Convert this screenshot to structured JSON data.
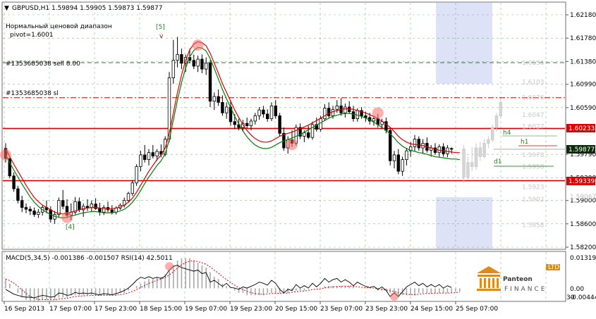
{
  "header": {
    "symbol_line": "GBPUSD,H1  1.59894 1.59905 1.59873 1.59877",
    "indicator_name": "Нормальный ценовой диапазон",
    "pivot_label": "pivot=1.6001"
  },
  "orders": {
    "sell_label": "#1353685038 sell 8.00",
    "sl_label": "#1353685038 sl"
  },
  "annotations": {
    "wave5": "[5]",
    "wave5_marker": "v",
    "wave4": "[4]",
    "h4": "h4",
    "h1": "h1",
    "d1": "d1"
  },
  "levels": {
    "red_upper": "1.60233",
    "red_lower": "1.59339",
    "current": "1.59877"
  },
  "faint_labels": [
    "1.6136",
    "1.6103",
    "1.6076",
    "1.6047",
    "1.6027",
    "1.5978",
    "1.5958",
    "1.5923",
    "1.5902",
    "1.5858"
  ],
  "price_axis": {
    "ticks": [
      "1.62180",
      "1.61780",
      "1.61380",
      "1.60990",
      "1.60590",
      "1.59790",
      "1.59390",
      "1.59000",
      "1.58600",
      "1.58200"
    ],
    "faint_tick": "1.59067"
  },
  "indicator_window": {
    "label": "MACD(5,34,5) -0.001386 -0.001507  RSI(14) 42.5011",
    "axis_ticks": [
      "0.013196",
      "0.00",
      "-0.004443",
      "30"
    ]
  },
  "time_axis": {
    "labels": [
      "16 Sep 2013",
      "17 Sep 07:00",
      "17 Sep 23:00",
      "18 Sep 15:00",
      "19 Sep 07:00",
      "19 Sep 23:00",
      "20 Sep 15:00",
      "23 Sep 07:00",
      "23 Sep 23:00",
      "24 Sep 15:00",
      "25 Sep 07:00"
    ]
  },
  "logo": {
    "name": "Panteon",
    "sub": "FINANCE",
    "badge": "LTD"
  },
  "colors": {
    "bull_candle": "#000000",
    "red_ma": "#dd0000",
    "green_ma": "#008000",
    "level_line": "#dd0000",
    "grid": "#2e7d32",
    "highlight_band": "#dfe3f7",
    "current_price_box": "#0a2a0a",
    "level_box": "#dd0000"
  },
  "candles": [
    [
      1.5989,
      1.5998,
      1.5965,
      1.5972
    ],
    [
      1.5972,
      1.5975,
      1.5938,
      1.5942
    ],
    [
      1.5942,
      1.5948,
      1.5915,
      1.592
    ],
    [
      1.592,
      1.5925,
      1.5895,
      1.59
    ],
    [
      1.59,
      1.5908,
      1.588,
      1.5888
    ],
    [
      1.5888,
      1.5895,
      1.5878,
      1.5885
    ],
    [
      1.5885,
      1.589,
      1.5875,
      1.5882
    ],
    [
      1.5882,
      1.5888,
      1.5872,
      1.5876
    ],
    [
      1.5876,
      1.5885,
      1.587,
      1.588
    ],
    [
      1.588,
      1.5892,
      1.5874,
      1.5888
    ],
    [
      1.5888,
      1.59,
      1.5878,
      1.5884
    ],
    [
      1.5884,
      1.589,
      1.5862,
      1.5868
    ],
    [
      1.5868,
      1.5882,
      1.586,
      1.5876
    ],
    [
      1.5876,
      1.5905,
      1.5872,
      1.59
    ],
    [
      1.59,
      1.5918,
      1.5885,
      1.589
    ],
    [
      1.589,
      1.5902,
      1.587,
      1.5875
    ],
    [
      1.5875,
      1.5895,
      1.5866,
      1.588
    ],
    [
      1.588,
      1.5906,
      1.5876,
      1.5898
    ],
    [
      1.5898,
      1.5905,
      1.588,
      1.5884
    ],
    [
      1.5884,
      1.5895,
      1.5872,
      1.589
    ],
    [
      1.589,
      1.5902,
      1.5882,
      1.5888
    ],
    [
      1.5888,
      1.59,
      1.588,
      1.5894
    ],
    [
      1.5894,
      1.5904,
      1.5884,
      1.5886
    ],
    [
      1.5886,
      1.5896,
      1.5874,
      1.588
    ],
    [
      1.588,
      1.5892,
      1.5875,
      1.5888
    ],
    [
      1.5888,
      1.5898,
      1.588,
      1.5884
    ],
    [
      1.5884,
      1.5892,
      1.5876,
      1.588
    ],
    [
      1.588,
      1.589,
      1.5876,
      1.5887
    ],
    [
      1.5887,
      1.5895,
      1.5884,
      1.5892
    ],
    [
      1.5892,
      1.5905,
      1.5888,
      1.59
    ],
    [
      1.59,
      1.5915,
      1.5896,
      1.5912
    ],
    [
      1.5912,
      1.5935,
      1.5908,
      1.593
    ],
    [
      1.593,
      1.5962,
      1.5925,
      1.5958
    ],
    [
      1.5958,
      1.5985,
      1.595,
      1.5978
    ],
    [
      1.5978,
      1.5995,
      1.5965,
      1.597
    ],
    [
      1.597,
      1.5988,
      1.596,
      1.5982
    ],
    [
      1.5982,
      1.5995,
      1.5972,
      1.5976
    ],
    [
      1.5976,
      1.5988,
      1.5968,
      1.5984
    ],
    [
      1.5984,
      1.5996,
      1.5974,
      1.5979
    ],
    [
      1.5979,
      1.601,
      1.5976,
      1.6005
    ],
    [
      1.6005,
      1.612,
      1.6,
      1.611
    ],
    [
      1.611,
      1.6175,
      1.61,
      1.614
    ],
    [
      1.614,
      1.618,
      1.6128,
      1.615
    ],
    [
      1.615,
      1.616,
      1.6125,
      1.6135
    ],
    [
      1.6135,
      1.615,
      1.612,
      1.6145
    ],
    [
      1.6145,
      1.616,
      1.6135,
      1.614
    ],
    [
      1.614,
      1.615,
      1.6125,
      1.613
    ],
    [
      1.613,
      1.6148,
      1.612,
      1.6142
    ],
    [
      1.6142,
      1.615,
      1.6118,
      1.6125
    ],
    [
      1.6125,
      1.6145,
      1.6115,
      1.6135
    ],
    [
      1.6135,
      1.614,
      1.606,
      1.607
    ],
    [
      1.607,
      1.6085,
      1.6055,
      1.6078
    ],
    [
      1.6078,
      1.609,
      1.6062,
      1.6068
    ],
    [
      1.6068,
      1.608,
      1.6045,
      1.605
    ],
    [
      1.605,
      1.6068,
      1.604,
      1.606
    ],
    [
      1.606,
      1.6072,
      1.6028,
      1.6035
    ],
    [
      1.6035,
      1.6048,
      1.6022,
      1.603
    ],
    [
      1.603,
      1.604,
      1.602,
      1.6025
    ],
    [
      1.6025,
      1.6038,
      1.6018,
      1.6032
    ],
    [
      1.6032,
      1.6042,
      1.6024,
      1.6028
    ],
    [
      1.6028,
      1.604,
      1.602,
      1.6036
    ],
    [
      1.6036,
      1.605,
      1.603,
      1.6045
    ],
    [
      1.6045,
      1.606,
      1.6038,
      1.6055
    ],
    [
      1.6055,
      1.6062,
      1.6042,
      1.6048
    ],
    [
      1.6048,
      1.6056,
      1.6035,
      1.604
    ],
    [
      1.604,
      1.6068,
      1.6036,
      1.6062
    ],
    [
      1.6062,
      1.6072,
      1.604,
      1.6045
    ],
    [
      1.6045,
      1.605,
      1.601,
      1.6015
    ],
    [
      1.6015,
      1.6025,
      1.5985,
      1.599
    ],
    [
      1.599,
      1.601,
      1.598,
      1.6004
    ],
    [
      1.6004,
      1.602,
      1.5992,
      1.5998
    ],
    [
      1.5998,
      1.603,
      1.5994,
      1.6025
    ],
    [
      1.6025,
      1.6032,
      1.6005,
      1.601
    ],
    [
      1.601,
      1.602,
      1.6,
      1.6016
    ],
    [
      1.6016,
      1.6028,
      1.6005,
      1.6008
    ],
    [
      1.6008,
      1.6035,
      1.6004,
      1.603
    ],
    [
      1.603,
      1.6042,
      1.6018,
      1.6022
    ],
    [
      1.6022,
      1.6045,
      1.6018,
      1.604
    ],
    [
      1.604,
      1.6065,
      1.6036,
      1.6058
    ],
    [
      1.6058,
      1.6068,
      1.604,
      1.6045
    ],
    [
      1.6045,
      1.6062,
      1.604,
      1.6056
    ],
    [
      1.6056,
      1.6072,
      1.605,
      1.6062
    ],
    [
      1.6062,
      1.6075,
      1.6045,
      1.605
    ],
    [
      1.605,
      1.6066,
      1.6042,
      1.606
    ],
    [
      1.606,
      1.607,
      1.6048,
      1.6052
    ],
    [
      1.6052,
      1.6062,
      1.6035,
      1.604
    ],
    [
      1.604,
      1.6058,
      1.6035,
      1.6054
    ],
    [
      1.6054,
      1.606,
      1.604,
      1.6045
    ],
    [
      1.6045,
      1.6052,
      1.6035,
      1.6042
    ],
    [
      1.6042,
      1.605,
      1.603,
      1.6036
    ],
    [
      1.6036,
      1.6045,
      1.6028,
      1.604
    ],
    [
      1.604,
      1.6048,
      1.6025,
      1.603
    ],
    [
      1.603,
      1.604,
      1.6022,
      1.6035
    ],
    [
      1.6035,
      1.6042,
      1.6015,
      1.602
    ],
    [
      1.602,
      1.6025,
      1.596,
      1.5968
    ],
    [
      1.5968,
      1.5985,
      1.5955,
      1.5978
    ],
    [
      1.5978,
      1.5988,
      1.5945,
      1.595
    ],
    [
      1.595,
      1.5975,
      1.5942,
      1.597
    ],
    [
      1.597,
      1.599,
      1.596,
      1.5985
    ],
    [
      1.5985,
      1.6,
      1.5975,
      1.5992
    ],
    [
      1.5992,
      1.6012,
      1.5985,
      1.6005
    ],
    [
      1.6005,
      1.601,
      1.5985,
      1.599
    ],
    [
      1.599,
      1.6005,
      1.598,
      1.5998
    ],
    [
      1.5998,
      1.6008,
      1.5982,
      1.5986
    ],
    [
      1.5986,
      1.5995,
      1.5975,
      1.599
    ],
    [
      1.599,
      1.5998,
      1.5978,
      1.5982
    ],
    [
      1.5982,
      1.5996,
      1.5975,
      1.5992
    ],
    [
      1.5992,
      1.5998,
      1.5975,
      1.598
    ],
    [
      1.598,
      1.5995,
      1.5974,
      1.599
    ],
    [
      1.5989,
      1.5991,
      1.598,
      1.5988
    ]
  ],
  "ghost_candles": [
    [
      1.5988,
      1.5995,
      1.593,
      1.594
    ],
    [
      1.594,
      1.5975,
      1.5935,
      1.5965
    ],
    [
      1.5965,
      1.5992,
      1.595,
      1.5958
    ],
    [
      1.5958,
      1.5998,
      1.5952,
      1.599
    ],
    [
      1.599,
      1.6,
      1.5968,
      1.5975
    ],
    [
      1.5975,
      1.6005,
      1.5972,
      1.5998
    ],
    [
      1.5998,
      1.601,
      1.599,
      1.6004
    ],
    [
      1.6004,
      1.603,
      1.6,
      1.6025
    ],
    [
      1.6025,
      1.605,
      1.6018,
      1.6045
    ],
    [
      1.6045,
      1.6075,
      1.604,
      1.6068
    ]
  ],
  "red_ma": [
    1.5989,
    1.5975,
    1.5962,
    1.595,
    1.5938,
    1.5926,
    1.5915,
    1.5905,
    1.5898,
    1.5892,
    1.5888,
    1.5884,
    1.588,
    1.5878,
    1.5877,
    1.5878,
    1.588,
    1.5882,
    1.5884,
    1.5886,
    1.5887,
    1.5888,
    1.5888,
    1.5887,
    1.5886,
    1.5886,
    1.5886,
    1.5887,
    1.5889,
    1.5892,
    1.5897,
    1.5904,
    1.5914,
    1.5926,
    1.5938,
    1.595,
    1.596,
    1.597,
    1.5978,
    1.599,
    1.6015,
    1.605,
    1.6085,
    1.6115,
    1.614,
    1.6158,
    1.6168,
    1.6172,
    1.617,
    1.6165,
    1.6152,
    1.6135,
    1.6118,
    1.61,
    1.6085,
    1.607,
    1.6055,
    1.6042,
    1.603,
    1.602,
    1.6012,
    1.6006,
    1.6002,
    1.6,
    1.6,
    1.6002,
    1.6006,
    1.601,
    1.6013,
    1.6015,
    1.6017,
    1.602,
    1.6023,
    1.6026,
    1.6029,
    1.6033,
    1.6037,
    1.6041,
    1.6045,
    1.6049,
    1.6052,
    1.6054,
    1.6056,
    1.6057,
    1.6057,
    1.6056,
    1.6054,
    1.6052,
    1.605,
    1.6047,
    1.6044,
    1.604,
    1.6036,
    1.6031,
    1.6025,
    1.6018,
    1.601,
    1.6004,
    1.6,
    1.5997,
    1.5996,
    1.5995,
    1.5994,
    1.5992,
    1.599,
    1.5988,
    1.5986,
    1.5985,
    1.5984,
    1.5983,
    1.5982,
    1.5982
  ],
  "green_ma": [
    1.5978,
    1.5965,
    1.5952,
    1.594,
    1.5928,
    1.5917,
    1.5906,
    1.5897,
    1.589,
    1.5884,
    1.588,
    1.5876,
    1.5873,
    1.5871,
    1.587,
    1.5871,
    1.5873,
    1.5875,
    1.5877,
    1.5879,
    1.588,
    1.5881,
    1.5881,
    1.588,
    1.5879,
    1.5879,
    1.5879,
    1.588,
    1.5882,
    1.5885,
    1.589,
    1.5897,
    1.5906,
    1.5917,
    1.5929,
    1.594,
    1.595,
    1.596,
    1.5968,
    1.598,
    1.6004,
    1.6038,
    1.6072,
    1.6102,
    1.6127,
    1.6146,
    1.6157,
    1.6162,
    1.6161,
    1.6156,
    1.6143,
    1.6126,
    1.6108,
    1.609,
    1.6074,
    1.6059,
    1.6044,
    1.6031,
    1.6019,
    1.6009,
    1.6001,
    1.5995,
    1.5991,
    1.5989,
    1.5989,
    1.5991,
    1.5995,
    1.5999,
    1.6002,
    1.6004,
    1.6007,
    1.601,
    1.6013,
    1.6017,
    1.6021,
    1.6025,
    1.6029,
    1.6033,
    1.6037,
    1.6041,
    1.6044,
    1.6046,
    1.6048,
    1.6049,
    1.6049,
    1.6048,
    1.6046,
    1.6044,
    1.6041,
    1.6038,
    1.6034,
    1.603,
    1.6025,
    1.602,
    1.6014,
    1.6007,
    1.5999,
    1.5993,
    1.5989,
    1.5986,
    1.5984,
    1.5982,
    1.5981,
    1.5979,
    1.5977,
    1.5975,
    1.5974,
    1.5973,
    1.5972,
    1.5971,
    1.5971,
    1.597
  ],
  "macd": [
    0.004,
    0.002,
    0.0,
    -0.002,
    -0.004,
    -0.005,
    -0.006,
    -0.006,
    -0.006,
    -0.005,
    -0.005,
    -0.005,
    -0.005,
    -0.004,
    -0.004,
    -0.004,
    -0.003,
    -0.003,
    -0.003,
    -0.003,
    -0.003,
    -0.003,
    -0.003,
    -0.003,
    -0.003,
    -0.003,
    -0.003,
    -0.003,
    -0.002,
    -0.002,
    -0.001,
    0.0,
    0.001,
    0.002,
    0.003,
    0.004,
    0.004,
    0.005,
    0.005,
    0.006,
    0.008,
    0.01,
    0.012,
    0.013,
    0.013,
    0.013,
    0.012,
    0.011,
    0.01,
    0.009,
    0.007,
    0.005,
    0.004,
    0.002,
    0.001,
    0.0,
    -0.001,
    -0.002,
    -0.002,
    -0.003,
    -0.003,
    -0.003,
    -0.003,
    -0.003,
    -0.002,
    -0.002,
    -0.002,
    -0.002,
    -0.002,
    -0.002,
    -0.001,
    -0.001,
    -0.001,
    -0.001,
    0.0,
    0.0,
    0.0,
    0.0,
    0.001,
    0.001,
    0.001,
    0.001,
    0.001,
    0.001,
    0.001,
    0.001,
    0.0,
    0.0,
    0.0,
    0.0,
    0.0,
    -0.001,
    -0.001,
    -0.001,
    -0.002,
    -0.002,
    -0.003,
    -0.003,
    -0.003,
    -0.003,
    -0.003,
    -0.002,
    -0.002,
    -0.002,
    -0.002,
    -0.002,
    -0.002,
    -0.002,
    -0.002,
    -0.002,
    -0.0015,
    -0.0014
  ],
  "rsi": [
    40,
    36,
    32,
    30,
    28,
    27,
    27,
    26,
    28,
    30,
    29,
    27,
    28,
    34,
    33,
    30,
    31,
    35,
    33,
    34,
    33,
    34,
    32,
    31,
    33,
    32,
    31,
    33,
    35,
    38,
    42,
    48,
    55,
    60,
    58,
    61,
    58,
    60,
    58,
    62,
    72,
    78,
    80,
    76,
    74,
    72,
    70,
    72,
    66,
    68,
    52,
    55,
    50,
    45,
    50,
    43,
    42,
    40,
    44,
    42,
    45,
    48,
    52,
    50,
    47,
    55,
    50,
    40,
    34,
    40,
    38,
    48,
    42,
    46,
    42,
    50,
    44,
    50,
    58,
    52,
    56,
    58,
    52,
    56,
    52,
    46,
    52,
    48,
    45,
    43,
    45,
    40,
    44,
    38,
    28,
    34,
    28,
    36,
    44,
    48,
    52,
    46,
    50,
    44,
    48,
    44,
    48,
    42,
    46,
    43
  ],
  "shaded_regions": [
    [
      106,
      111
    ],
    [
      106,
      111
    ]
  ]
}
